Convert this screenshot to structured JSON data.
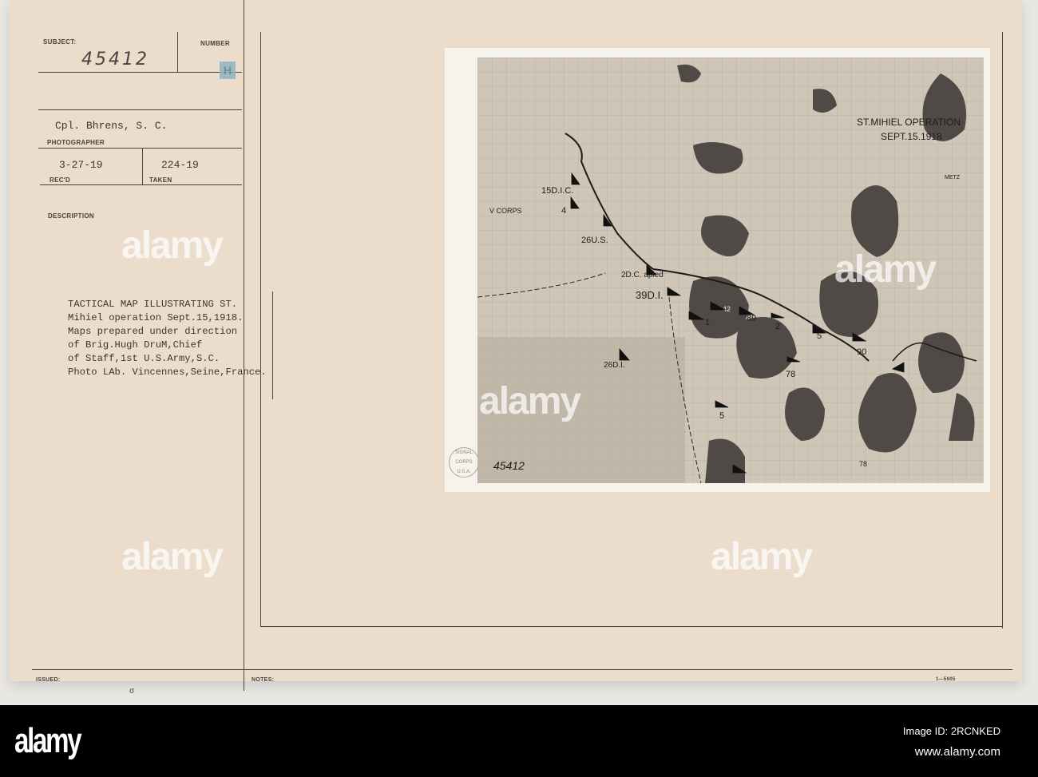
{
  "card": {
    "subject_label": "SUBJECT:",
    "subject_value": "45412",
    "number_label": "NUMBER",
    "number_stamp": "H",
    "photographer_value": "Cpl. Bhrens, S. C.",
    "photographer_label": "PHOTOGRAPHER",
    "recd_value": "3-27-19",
    "recd_label": "REC'D",
    "taken_value": "224-19",
    "taken_label": "TAKEN",
    "description_label": "DESCRIPTION",
    "description_lines": [
      "TACTICAL MAP ILLUSTRATING ST.",
      "Mihiel operation Sept.15,1918.",
      "Maps prepared under direction",
      "of Brig.Hugh DruM,Chief",
      "of Staff,1st U.S.Army,S.C.",
      "Photo LAb. Vincennes,Seine,France."
    ],
    "issued_label": "ISSUED:",
    "issued_mark": "σ",
    "notes_label": "NOTES:",
    "form_number": "1—5605"
  },
  "map": {
    "title_line1": "ST.MIHIEL OPERATION",
    "title_line2": "SEPT.15.1918",
    "city": "METZ",
    "photo_number": "45412",
    "seal_text": "SIGNAL CORPS U.S.A.",
    "units": [
      "15D.I.C.",
      "4",
      "V CORPS",
      "26U.S.",
      "2D.C. apied",
      "39D.I.",
      "42",
      "89",
      "2",
      "1",
      "5",
      "90",
      "78",
      "26D.I.",
      "5",
      "78"
    ]
  },
  "watermark": "alamy",
  "footer": {
    "logo": "alamy",
    "image_id": "Image ID: 2RCNKED",
    "url": "www.alamy.com"
  }
}
